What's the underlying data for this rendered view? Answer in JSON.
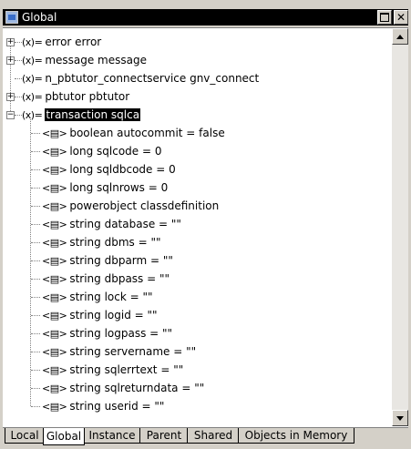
{
  "window": {
    "title": "Global"
  },
  "tree": {
    "nodes": [
      {
        "glyph": "(x)=",
        "label": "error error",
        "expander": "+"
      },
      {
        "glyph": "(x)=",
        "label": "message message",
        "expander": "+"
      },
      {
        "glyph": "(x)=",
        "label": "n_pbtutor_connectservice gnv_connect",
        "expander": ""
      },
      {
        "glyph": "(x)=",
        "label": "pbtutor pbtutor",
        "expander": "+"
      },
      {
        "glyph": "(x)=",
        "label": "transaction sqlca",
        "expander": "−"
      }
    ],
    "children": [
      {
        "glyph": "<▤>",
        "label": "boolean autocommit = false"
      },
      {
        "glyph": "<▤>",
        "label": "long sqlcode = 0"
      },
      {
        "glyph": "<▤>",
        "label": "long sqldbcode = 0"
      },
      {
        "glyph": "<▤>",
        "label": "long sqlnrows = 0"
      },
      {
        "glyph": "<▤>",
        "label": "powerobject classdefinition"
      },
      {
        "glyph": "<▤>",
        "label": "string database = \"\""
      },
      {
        "glyph": "<▤>",
        "label": "string dbms = \"\""
      },
      {
        "glyph": "<▤>",
        "label": "string dbparm = \"\""
      },
      {
        "glyph": "<▤>",
        "label": "string dbpass = \"\""
      },
      {
        "glyph": "<▤>",
        "label": "string lock = \"\""
      },
      {
        "glyph": "<▤>",
        "label": "string logid = \"\""
      },
      {
        "glyph": "<▤>",
        "label": "string logpass = \"\""
      },
      {
        "glyph": "<▤>",
        "label": "string servername = \"\""
      },
      {
        "glyph": "<▤>",
        "label": "string sqlerrtext = \"\""
      },
      {
        "glyph": "<▤>",
        "label": "string sqlreturndata = \"\""
      },
      {
        "glyph": "<▤>",
        "label": "string userid = \"\""
      }
    ]
  },
  "tabs": [
    {
      "label": "Local",
      "active": false
    },
    {
      "label": "Global",
      "active": true
    },
    {
      "label": "Instance",
      "active": false
    },
    {
      "label": "Parent",
      "active": false
    },
    {
      "label": "Shared",
      "active": false
    },
    {
      "label": "Objects in Memory",
      "active": false
    }
  ],
  "colors": {
    "titlebar": "#000000",
    "selection": "#000000",
    "chrome": "#d4d0c8"
  }
}
